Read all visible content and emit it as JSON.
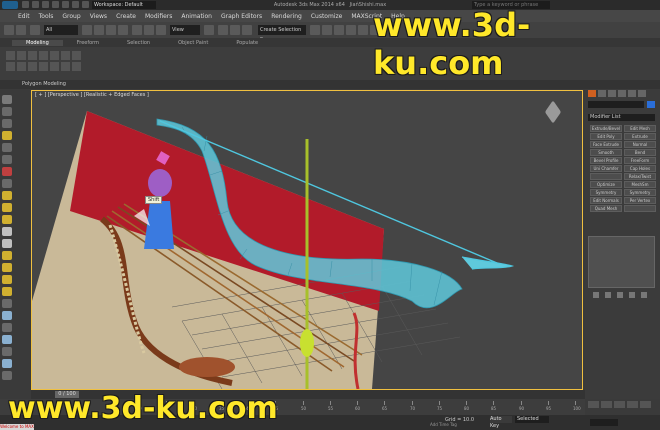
{
  "app": {
    "title": "Autodesk 3ds Max  2014 x64",
    "file_name": "JiańShishi.max",
    "workspace_label": "Workspace: Default",
    "search_placeholder": "Type a keyword or phrase"
  },
  "menu": [
    "Edit",
    "Tools",
    "Group",
    "Views",
    "Create",
    "Modifiers",
    "Animation",
    "Graph Editors",
    "Rendering",
    "Customize",
    "MAXScript",
    "Help"
  ],
  "toolbar": {
    "filter_value": "All",
    "view_value": "View",
    "selset_value": "Create Selection Se"
  },
  "ribbon": {
    "tabs": [
      "Modeling",
      "Freeform",
      "Selection",
      "Object Paint",
      "Populate"
    ],
    "active_tab": "Modeling",
    "panel_label": "Polygon Modeling"
  },
  "viewport": {
    "label": "[ + ] [Perspective ] [Realistic + Edged Faces ]",
    "tooltip": "Shift"
  },
  "command_panel": {
    "modifier_list_label": "Modifier List",
    "modifier_buttons": [
      "Extrude/Bevel",
      "Edit Mesh",
      "Edit Poly",
      "Extrude",
      "Face Extrude",
      "Normal",
      "Smooth",
      "Bend",
      "Bevel Profile",
      "FreeForm",
      "Uni Chamfer",
      "Cap Holes",
      "",
      "Relax/Twist",
      "Optimize",
      "MeshSm",
      "Symmetry",
      "Symmetry",
      "Edit Normals",
      "Per Vertex",
      "Quad Mesh",
      ""
    ]
  },
  "timeline": {
    "slider_label": "0 / 100",
    "ticks": [
      "0",
      "5",
      "10",
      "15",
      "20",
      "25",
      "30",
      "35",
      "40",
      "45",
      "50",
      "55",
      "60",
      "65",
      "70",
      "75",
      "80",
      "85",
      "90",
      "95",
      "100"
    ]
  },
  "status": {
    "grid_label": "Grid = 10.0",
    "auto_key_label": "Auto Key",
    "selection_filter": "Selected",
    "set_key_label": "Set Key",
    "add_time_tag": "Add Time Tag",
    "welcome_label": "Welcome to MAX"
  },
  "watermarks": {
    "top": "www.3d-ku.com",
    "bottom": "www.3d-ku.com"
  },
  "colors": {
    "viewport_border": "#f0c040",
    "bow_wire": "#4fc7df",
    "accent": "#d06020",
    "watermark": "#ffe82a"
  }
}
